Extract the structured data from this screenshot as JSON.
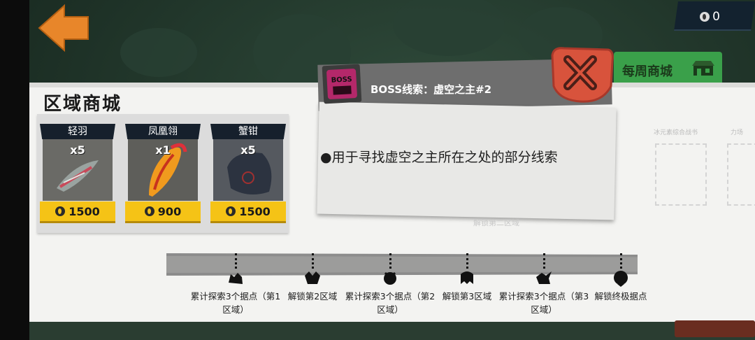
{
  "header": {
    "coin_count": "0"
  },
  "section_title": "区域商城",
  "weekly_shop_tab": {
    "label": "每周商城"
  },
  "shop_items": [
    {
      "name": "轻羽",
      "qty": "x5",
      "price": "1500"
    },
    {
      "name": "凤凰翎",
      "qty": "x1",
      "price": "900"
    },
    {
      "name": "蟹钳",
      "qty": "x5",
      "price": "1500"
    }
  ],
  "popup": {
    "title": "BOSS线索：虚空之主#2",
    "description": "●用于寻找虚空之主所在之处的部分线索",
    "boss_badge": "BOSS"
  },
  "faint_right": {
    "label_1": "冰元素综合战书",
    "label_2": "力场"
  },
  "unlock_divider": "解锁第二区域",
  "milestones": [
    {
      "label": "累计探索3个据点（第1区域）"
    },
    {
      "label": "解锁第2区域"
    },
    {
      "label": "累计探索3个据点（第2区域）"
    },
    {
      "label": "解锁第3区域"
    },
    {
      "label": "累计探索3个据点（第3区域）"
    },
    {
      "label": "解锁终极据点"
    }
  ],
  "colors": {
    "accent_gold": "#f5c316",
    "weekly_green": "#3aa04a",
    "back_orange": "#e8862a",
    "close_red": "#d8533c"
  }
}
